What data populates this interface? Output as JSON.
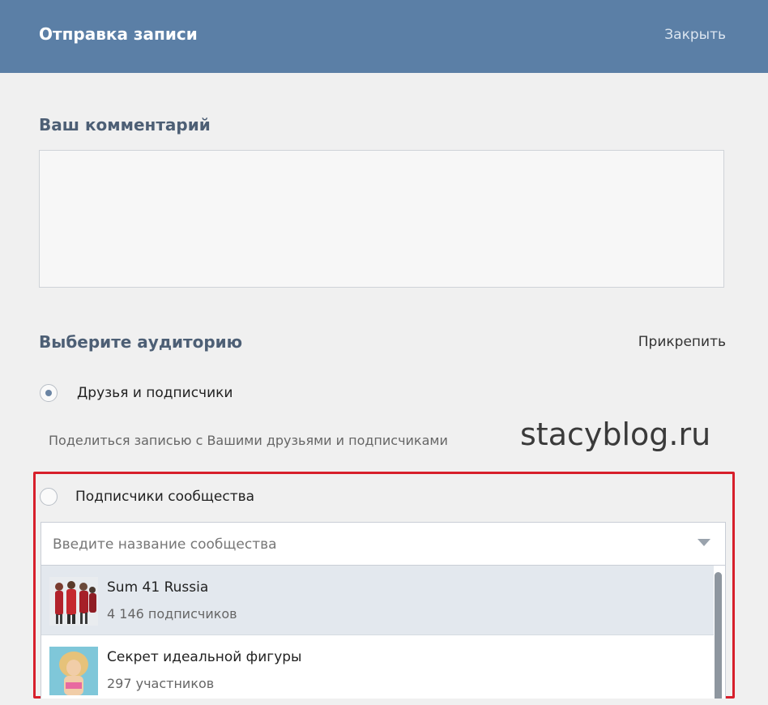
{
  "dialog": {
    "title": "Отправка записи",
    "close_label": "Закрыть"
  },
  "comment": {
    "title": "Ваш комментарий",
    "value": ""
  },
  "audience": {
    "title": "Выберите аудиторию",
    "attach_label": "Прикрепить",
    "options": [
      {
        "label": "Друзья и подписчики",
        "hint": "Поделиться записью с Вашими друзьями и подписчиками",
        "checked": true
      },
      {
        "label": "Подписчики сообщества",
        "checked": false
      }
    ]
  },
  "community_search": {
    "placeholder": "Введите название сообщества",
    "value": "",
    "results": [
      {
        "name": "Sum 41 Russia",
        "count": "4 146 подписчиков",
        "icon": "band-photo",
        "highlighted": true
      },
      {
        "name": "Секрет идеальной фигуры",
        "count": "297 участников",
        "icon": "woman-photo",
        "highlighted": false
      }
    ]
  },
  "watermark": "stacyblog.ru",
  "colors": {
    "header_bg": "#5b7fa6",
    "highlight_border": "#d71f2b",
    "hover_row": "#e3e8ee"
  }
}
